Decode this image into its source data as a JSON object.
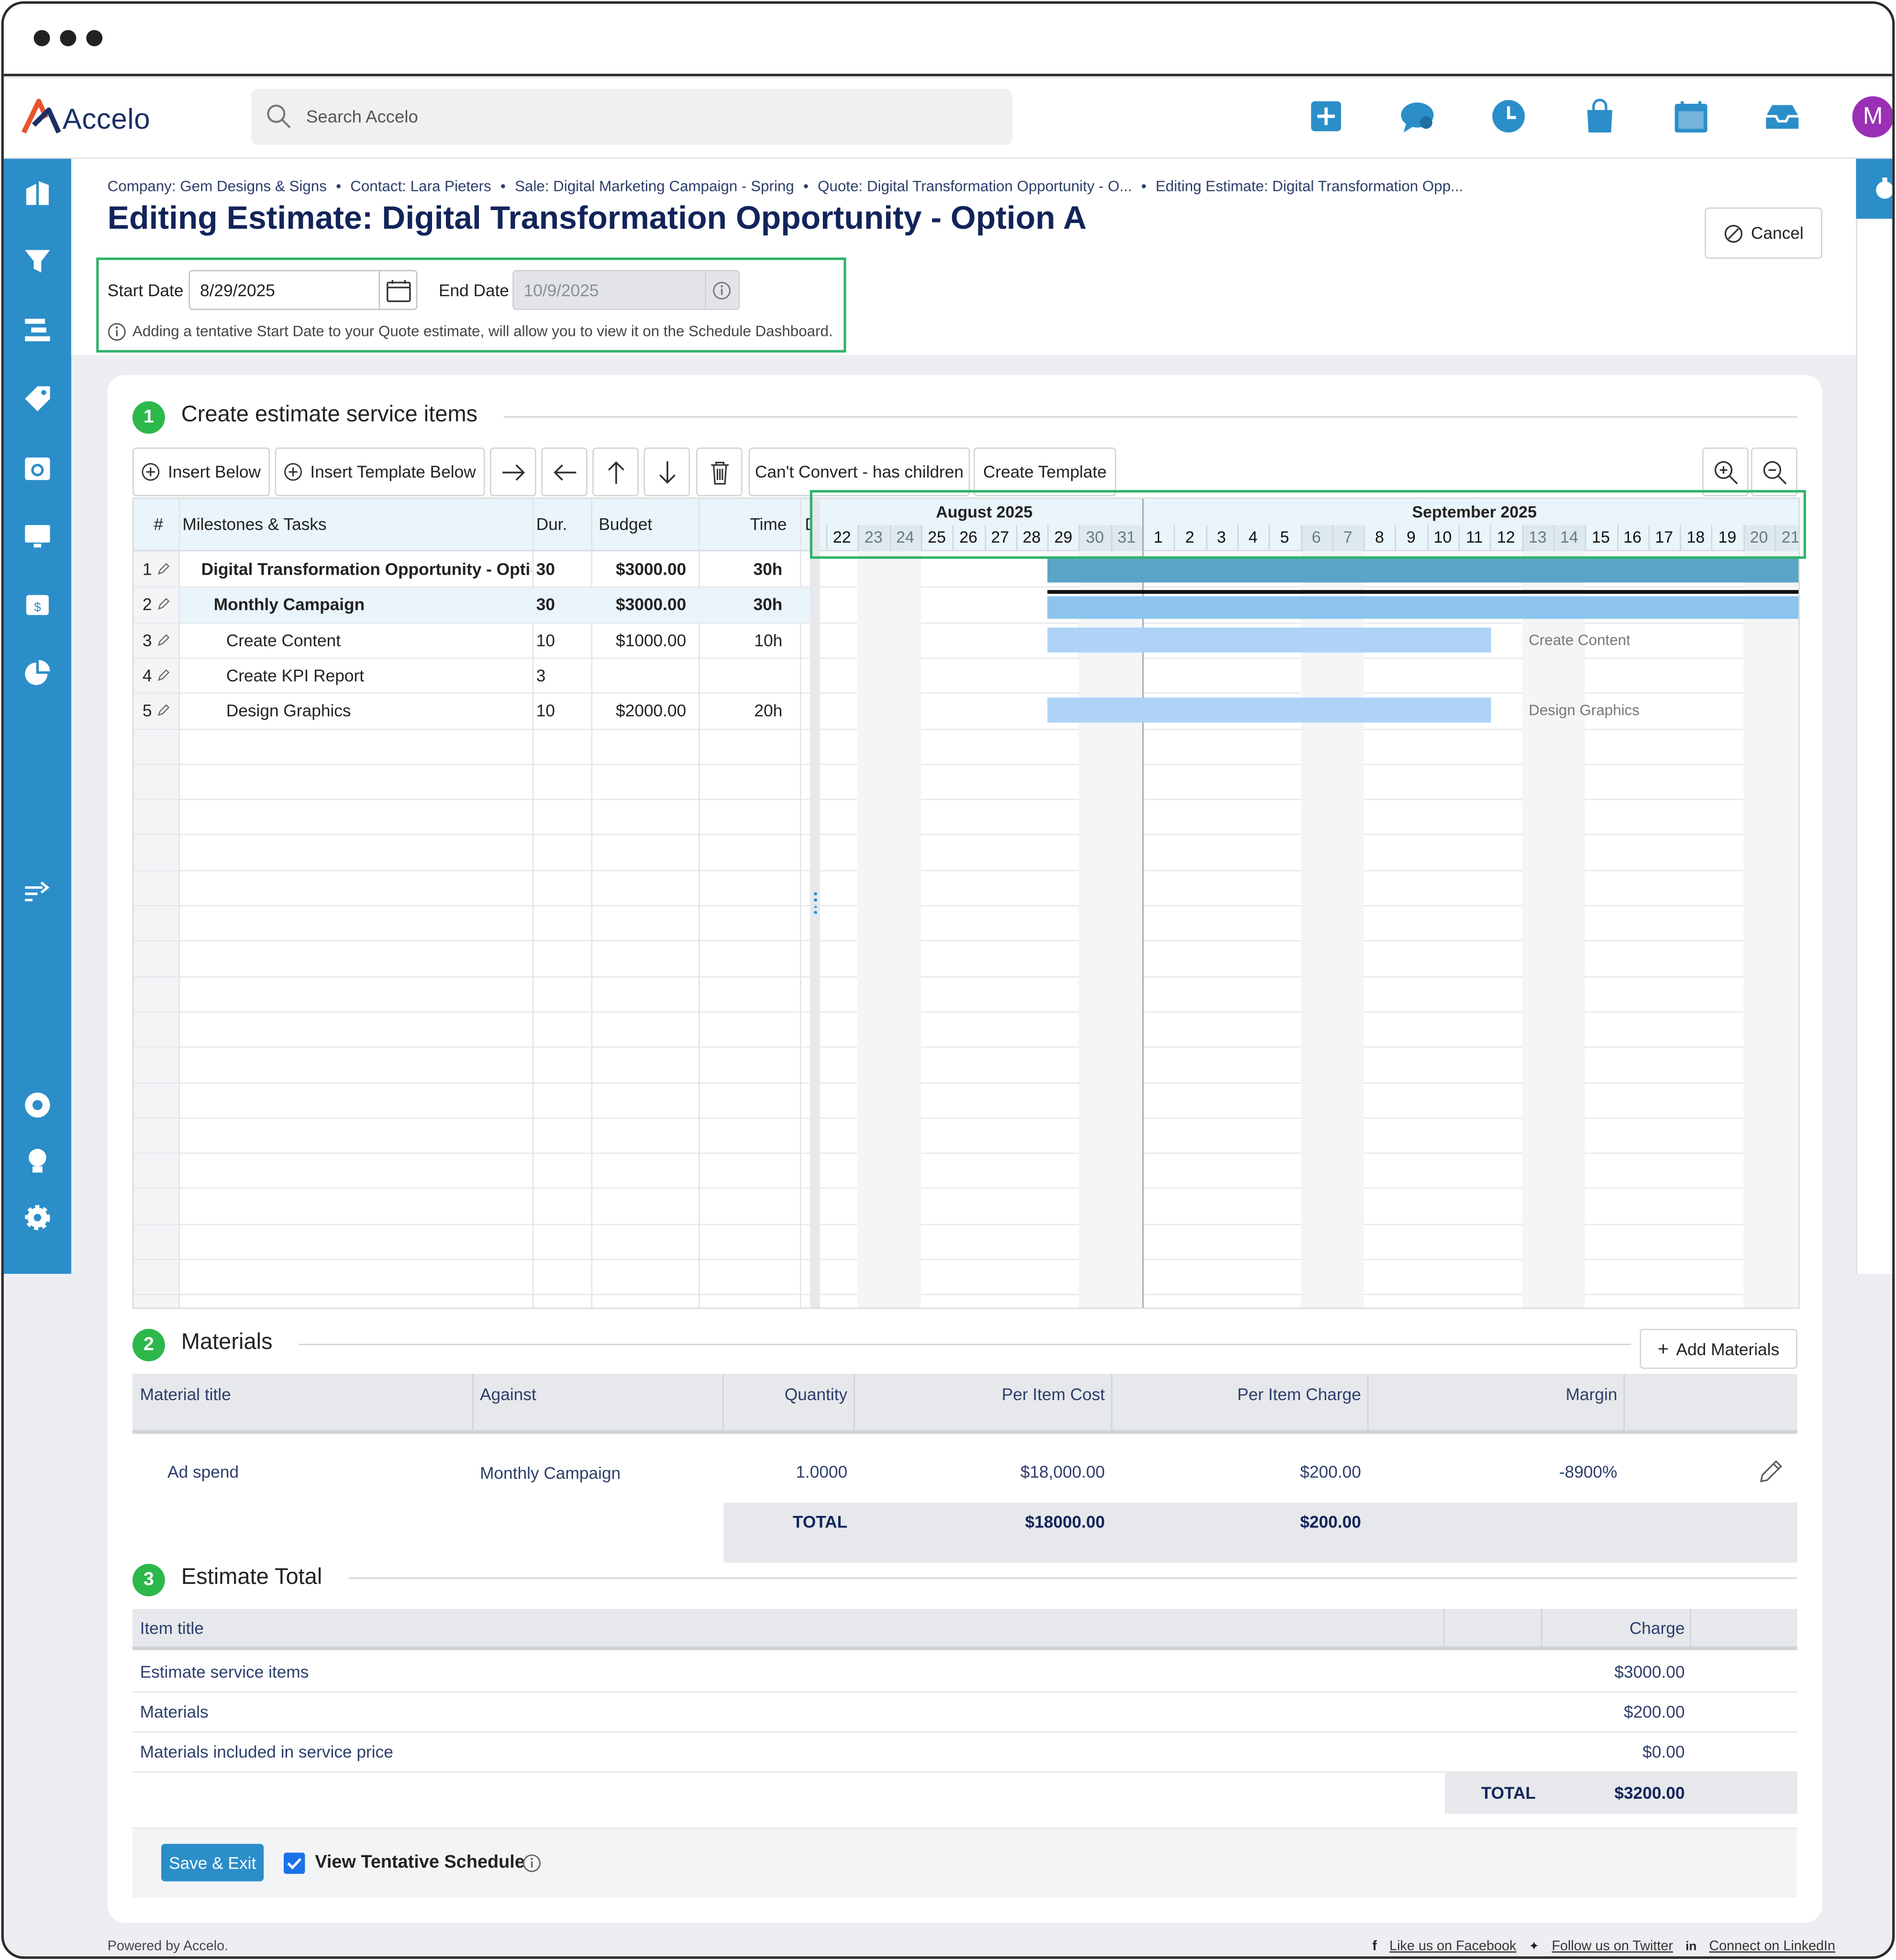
{
  "app": {
    "logo_text": "Accelo",
    "search_placeholder": "Search Accelo",
    "avatar_initial": "M"
  },
  "breadcrumbs": [
    "Company: Gem Designs & Signs",
    "Contact: Lara Pieters",
    "Sale: Digital Marketing Campaign - Spring",
    "Quote: Digital Transformation Opportunity - O...",
    "Editing Estimate: Digital Transformation Opp..."
  ],
  "page_title": "Editing Estimate: Digital Transformation Opportunity - Option A",
  "cancel_label": "Cancel",
  "dates": {
    "start_label": "Start Date",
    "start_value": "8/29/2025",
    "end_label": "End Date",
    "end_value": "10/9/2025",
    "hint": "Adding a tentative Start Date to your Quote estimate, will allow you to view it on the Schedule Dashboard."
  },
  "section1": {
    "number": "1",
    "title": "Create estimate service items",
    "toolbar": {
      "insert_below": "Insert Below",
      "insert_template_below": "Insert Template Below",
      "cant_convert": "Can't Convert - has children",
      "create_template": "Create Template"
    },
    "columns": {
      "num": "#",
      "name": "Milestones & Tasks",
      "dur": "Dur.",
      "budget": "Budget",
      "time": "Time",
      "d": "D"
    },
    "rows": [
      {
        "num": "1",
        "name": "Digital Transformation Opportunity - Option A",
        "dur": "30",
        "budget": "$3000.00",
        "time": "30h"
      },
      {
        "num": "2",
        "name": "Monthly Campaign",
        "dur": "30",
        "budget": "$3000.00",
        "time": "30h"
      },
      {
        "num": "3",
        "name": "Create Content",
        "dur": "10",
        "budget": "$1000.00",
        "time": "10h"
      },
      {
        "num": "4",
        "name": "Create KPI Report",
        "dur": "3",
        "budget": "",
        "time": ""
      },
      {
        "num": "5",
        "name": "Design Graphics",
        "dur": "10",
        "budget": "$2000.00",
        "time": "20h"
      }
    ],
    "gantt": {
      "month1": "August 2025",
      "month2": "September 2025",
      "days": [
        "22",
        "23",
        "24",
        "25",
        "26",
        "27",
        "28",
        "29",
        "30",
        "31",
        "1",
        "2",
        "3",
        "4",
        "5",
        "6",
        "7",
        "8",
        "9",
        "10",
        "11",
        "12",
        "13",
        "14",
        "15",
        "16",
        "17",
        "18",
        "19",
        "20",
        "21"
      ],
      "weekend_days": [
        "23",
        "24",
        "30",
        "31",
        "6",
        "7",
        "13",
        "14",
        "20",
        "21"
      ],
      "bar_labels": {
        "create_content": "Create Content",
        "design_graphics": "Design Graphics"
      },
      "colors": {
        "summary_bar": "#5aa4c9",
        "milestone_bar": "#8cc4ee",
        "task_bar": "#aed3f7"
      }
    }
  },
  "section2": {
    "number": "2",
    "title": "Materials",
    "add_label": "Add Materials",
    "columns": {
      "title": "Material title",
      "against": "Against",
      "quantity": "Quantity",
      "cost": "Per Item Cost",
      "charge": "Per Item Charge",
      "margin": "Margin"
    },
    "row": {
      "title": "Ad spend",
      "against": "Monthly Campaign",
      "quantity": "1.0000",
      "cost": "$18,000.00",
      "charge": "$200.00",
      "margin": "-8900%"
    },
    "total": {
      "label": "TOTAL",
      "cost": "$18000.00",
      "charge": "$200.00"
    }
  },
  "section3": {
    "number": "3",
    "title": "Estimate Total",
    "columns": {
      "title": "Item title",
      "charge": "Charge"
    },
    "rows": [
      {
        "title": "Estimate service items",
        "charge": "$3000.00"
      },
      {
        "title": "Materials",
        "charge": "$200.00"
      },
      {
        "title": "Materials included in service price",
        "charge": "$0.00"
      }
    ],
    "total": {
      "label": "TOTAL",
      "value": "$3200.00"
    }
  },
  "actions": {
    "save_exit": "Save & Exit",
    "view_tentative": "View Tentative Schedule",
    "view_tentative_checked": true
  },
  "footer": {
    "powered": "Powered by Accelo.",
    "facebook": "Like us on Facebook",
    "twitter": "Follow us on Twitter",
    "linkedin": "Connect on LinkedIn"
  },
  "colors": {
    "brand_blue": "#2b8ec9",
    "title_navy": "#12245a",
    "badge_green": "#2cb84a",
    "highlight_green": "#2fb36a",
    "avatar_purple": "#9b2fb5"
  }
}
